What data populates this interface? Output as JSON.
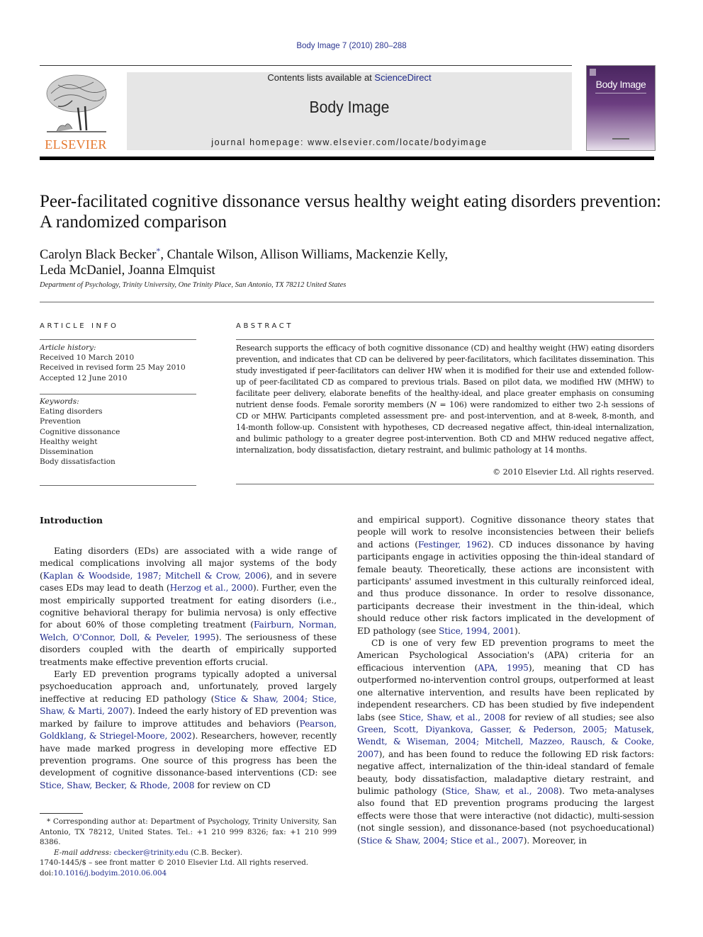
{
  "journal_citation": "Body Image 7 (2010) 280–288",
  "header": {
    "publisher_logo_text": "ELSEVIER",
    "contents_prefix": "Contents lists available at ",
    "contents_link": "ScienceDirect",
    "journal_name": "Body Image",
    "homepage": "journal homepage: www.elsevier.com/locate/bodyimage",
    "cover_title": "Body Image"
  },
  "colors": {
    "link": "#1f2a8a",
    "elsevier_orange": "#e5762b",
    "banner_bg": "#e6e6e6",
    "cover_purple": "#4a2660"
  },
  "article": {
    "title": "Peer-facilitated cognitive dissonance versus healthy weight eating disorders prevention: A randomized comparison",
    "authors_line1_first": "Carolyn Black Becker",
    "authors_marker": "*",
    "authors_line1_rest": ", Chantale Wilson, Allison Williams, Mackenzie Kelly,",
    "authors_line2": "Leda McDaniel, Joanna Elmquist",
    "affiliation": "Department of Psychology, Trinity University, One Trinity Place, San Antonio, TX 78212 United States"
  },
  "article_info": {
    "heading": "ARTICLE INFO",
    "history_label": "Article history:",
    "history": [
      "Received 10 March 2010",
      "Received in revised form 25 May 2010",
      "Accepted 12 June 2010"
    ],
    "keywords_label": "Keywords:",
    "keywords": [
      "Eating disorders",
      "Prevention",
      "Cognitive dissonance",
      "Healthy weight",
      "Dissemination",
      "Body dissatisfaction"
    ]
  },
  "abstract": {
    "heading": "ABSTRACT",
    "text_a": "Research supports the efficacy of both cognitive dissonance (CD) and healthy weight (HW) eating disorders prevention, and indicates that CD can be delivered by peer-facilitators, which facilitates dissemination. This study investigated if peer-facilitators can deliver HW when it is modified for their use and extended follow-up of peer-facilitated CD as compared to previous trials. Based on pilot data, we modified HW (MHW) to facilitate peer delivery, elaborate benefits of the healthy-ideal, and place greater emphasis on consuming nutrient dense foods. Female sorority members (",
    "n_symbol": "N",
    "text_b": " = 106) were randomized to either two 2-h sessions of CD or MHW. Participants completed assessment pre- and post-intervention, and at 8-week, 8-month, and 14-month follow-up. Consistent with hypotheses, CD decreased negative affect, thin-ideal internalization, and bulimic pathology to a greater degree post-intervention. Both CD and MHW reduced negative affect, internalization, body dissatisfaction, dietary restraint, and bulimic pathology at 14 months.",
    "copyright": "© 2010 Elsevier Ltd. All rights reserved."
  },
  "body": {
    "intro_heading": "Introduction",
    "left": {
      "p1": [
        {
          "t": "Eating disorders (EDs) are associated with a wide range of medical complications involving all major systems of the body ("
        },
        {
          "t": "Kaplan & Woodside, 1987; Mitchell & Crow, 2006",
          "link": true
        },
        {
          "t": "), and in severe cases EDs may lead to death ("
        },
        {
          "t": "Herzog et al., 2000",
          "link": true
        },
        {
          "t": "). Further, even the most empirically supported treatment for eating disorders (i.e., cognitive behavioral therapy for bulimia nervosa) is only effective for about 60% of those completing treatment ("
        },
        {
          "t": "Fairburn, Norman, Welch, O'Connor, Doll, & Peveler, 1995",
          "link": true
        },
        {
          "t": "). The seriousness of these disorders coupled with the dearth of empirically supported treatments make effective prevention efforts crucial."
        }
      ],
      "p2": [
        {
          "t": "Early ED prevention programs typically adopted a universal psychoeducation approach and, unfortunately, proved largely ineffective at reducing ED pathology ("
        },
        {
          "t": "Stice & Shaw, 2004; Stice, Shaw, & Marti, 2007",
          "link": true
        },
        {
          "t": "). Indeed the early history of ED prevention was marked by failure to improve attitudes and behaviors ("
        },
        {
          "t": "Pearson, Goldklang, & Striegel-Moore, 2002",
          "link": true
        },
        {
          "t": "). Researchers, however, recently have made marked progress in developing more effective ED prevention programs. One source of this progress has been the development of cognitive dissonance-based interventions (CD: see "
        },
        {
          "t": "Stice, Shaw, Becker, & Rhode, 2008",
          "link": true
        },
        {
          "t": " for review on CD"
        }
      ]
    },
    "right": {
      "p1": [
        {
          "t": "and empirical support). Cognitive dissonance theory states that people will work to resolve inconsistencies between their beliefs and actions ("
        },
        {
          "t": "Festinger, 1962",
          "link": true
        },
        {
          "t": "). CD induces dissonance by having participants engage in activities opposing the thin-ideal standard of female beauty. Theoretically, these actions are inconsistent with participants' assumed investment in this culturally reinforced ideal, and thus produce dissonance. In order to resolve dissonance, participants decrease their investment in the thin-ideal, which should reduce other risk factors implicated in the development of ED pathology (see "
        },
        {
          "t": "Stice, 1994, 2001",
          "link": true
        },
        {
          "t": ")."
        }
      ],
      "p2": [
        {
          "t": "CD is one of very few ED prevention programs to meet the American Psychological Association's (APA) criteria for an efficacious intervention ("
        },
        {
          "t": "APA, 1995",
          "link": true
        },
        {
          "t": "), meaning that CD has outperformed no-intervention control groups, outperformed at least one alternative intervention, and results have been replicated by independent researchers. CD has been studied by five independent labs (see "
        },
        {
          "t": "Stice, Shaw, et al., 2008",
          "link": true
        },
        {
          "t": " for review of all studies; see also "
        },
        {
          "t": "Green, Scott, Diyankova, Gasser, & Pederson, 2005; Matusek, Wendt, & Wiseman, 2004; Mitchell, Mazzeo, Rausch, & Cooke, 2007",
          "link": true
        },
        {
          "t": "), and has been found to reduce the following ED risk factors: negative affect, internalization of the thin-ideal standard of female beauty, body dissatisfaction, maladaptive dietary restraint, and bulimic pathology ("
        },
        {
          "t": "Stice, Shaw, et al., 2008",
          "link": true
        },
        {
          "t": "). Two meta-analyses also found that ED prevention programs producing the largest effects were those that were interactive (not didactic), multi-session (not single session), and dissonance-based (not psychoeducational) ("
        },
        {
          "t": "Stice & Shaw, 2004; Stice et al., 2007",
          "link": true
        },
        {
          "t": "). Moreover, in"
        }
      ]
    }
  },
  "footnote": {
    "marker": "*",
    "corresponding": " Corresponding author at: Department of Psychology, Trinity University, San Antonio, TX 78212, United States. Tel.: +1 210 999 8326; fax: +1 210 999 8386.",
    "email_label": "E-mail address:",
    "email": "cbecker@trinity.edu",
    "email_suffix": " (C.B. Becker)."
  },
  "front_matter": {
    "issn_line": "1740-1445/$ – see front matter © 2010 Elsevier Ltd. All rights reserved.",
    "doi_prefix": "doi:",
    "doi": "10.1016/j.bodyim.2010.06.004"
  }
}
